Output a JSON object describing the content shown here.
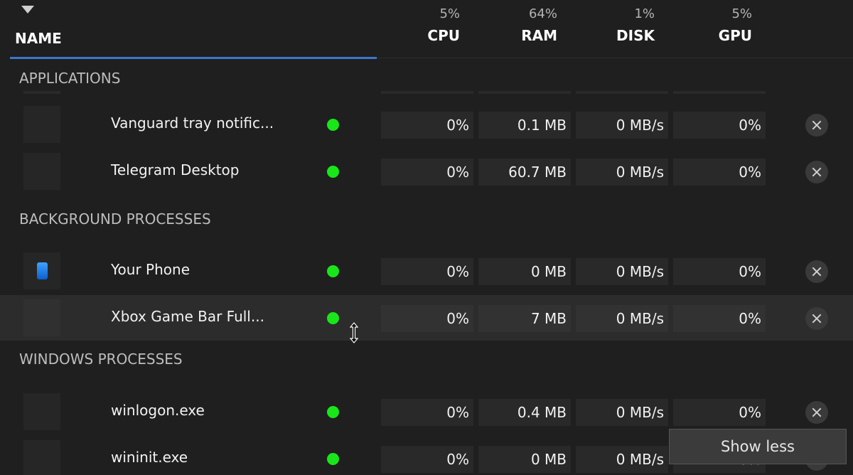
{
  "header": {
    "name_label": "NAME",
    "columns": [
      {
        "key": "cpu",
        "percent": "5%",
        "label": "CPU"
      },
      {
        "key": "ram",
        "percent": "64%",
        "label": "RAM"
      },
      {
        "key": "disk",
        "percent": "1%",
        "label": "DISK"
      },
      {
        "key": "gpu",
        "percent": "5%",
        "label": "GPU"
      }
    ],
    "accent_color": "#3a78c9"
  },
  "sections": [
    {
      "title": "APPLICATIONS",
      "rows": [
        {
          "name": "Vanguard tray notific...",
          "status": "running",
          "cpu": "0%",
          "ram": "0.1 MB",
          "disk": "0 MB/s",
          "gpu": "0%",
          "icon": "blank-app-icon"
        },
        {
          "name": "Telegram Desktop",
          "status": "running",
          "cpu": "0%",
          "ram": "60.7 MB",
          "disk": "0 MB/s",
          "gpu": "0%",
          "icon": "blank-app-icon"
        }
      ]
    },
    {
      "title": "BACKGROUND PROCESSES",
      "rows": [
        {
          "name": "Your Phone",
          "status": "running",
          "cpu": "0%",
          "ram": "0 MB",
          "disk": "0 MB/s",
          "gpu": "0%",
          "icon": "phone-icon"
        },
        {
          "name": "Xbox Game Bar Full...",
          "status": "running",
          "cpu": "0%",
          "ram": "7 MB",
          "disk": "0 MB/s",
          "gpu": "0%",
          "icon": "blank-app-icon"
        }
      ]
    },
    {
      "title": "WINDOWS PROCESSES",
      "rows": [
        {
          "name": "winlogon.exe",
          "status": "running",
          "cpu": "0%",
          "ram": "0.4 MB",
          "disk": "0 MB/s",
          "gpu": "0%",
          "icon": "blank-app-icon"
        },
        {
          "name": "wininit.exe",
          "status": "running",
          "cpu": "0%",
          "ram": "0 MB",
          "disk": "0 MB/s",
          "gpu": "0%",
          "icon": "blank-app-icon"
        }
      ]
    }
  ],
  "tooltip": {
    "text": "Show less"
  },
  "status_color": "#19e619"
}
